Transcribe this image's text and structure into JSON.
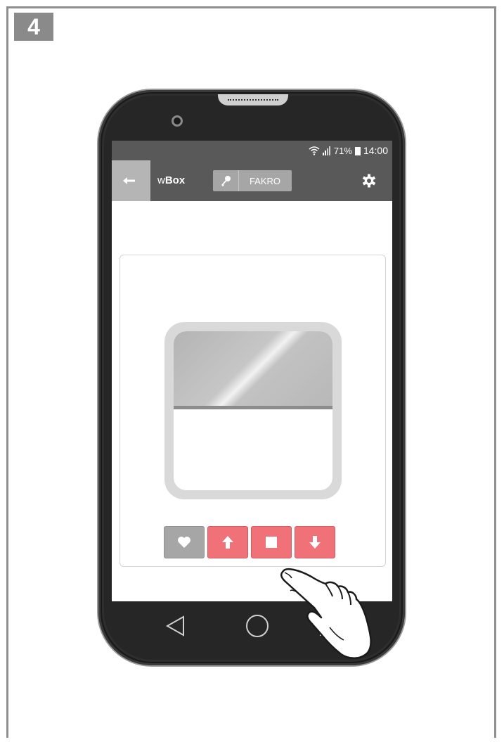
{
  "step_number": "4",
  "status_bar": {
    "battery": "71%",
    "time": "14:00"
  },
  "app_bar": {
    "title_prefix": "w",
    "title_bold": "Box",
    "account_label": "FAKRO"
  },
  "icons": {
    "back": "arrow-left-icon",
    "key": "key-icon",
    "settings": "gear-icon",
    "favorite": "heart-icon",
    "up": "arrow-up-icon",
    "stop": "stop-icon",
    "down": "arrow-down-icon",
    "nav_back": "triangle-back-icon",
    "nav_home": "circle-home-icon",
    "nav_recent": "square-recent-icon"
  },
  "device": {
    "blind_position_fraction": 0.47
  },
  "colors": {
    "bar": "#595959",
    "accent_red": "#f07278",
    "favorite_gray": "#a6a6a6"
  }
}
